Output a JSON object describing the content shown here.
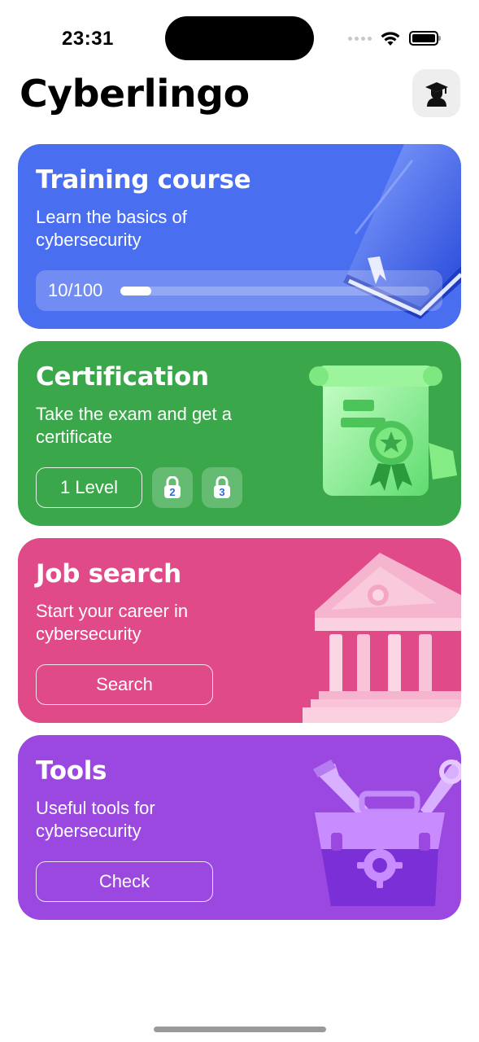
{
  "status_bar": {
    "time": "23:31"
  },
  "header": {
    "app_title": "Cyberlingo",
    "profile_icon": "student-graduation-cap-icon"
  },
  "cards": {
    "training": {
      "title": "Training course",
      "description": "Learn the basics of cybersecurity",
      "progress_text": "10/100",
      "progress_value": 10,
      "progress_max": 100,
      "color": "#4a6ef0",
      "illustration": "book-icon"
    },
    "certification": {
      "title": "Certification",
      "description": "Take the exam and get a certificate",
      "level_label": "1 Level",
      "locked_levels": [
        "2",
        "3"
      ],
      "color": "#3aa84a",
      "illustration": "certificate-scroll-icon"
    },
    "job_search": {
      "title": "Job search",
      "description": "Start your career in cybersecurity",
      "button_label": "Search",
      "color": "#e04a88",
      "illustration": "building-icon"
    },
    "tools": {
      "title": "Tools",
      "description": "Useful tools for cybersecurity",
      "button_label": "Check",
      "color": "#9a48e0",
      "illustration": "toolbox-icon"
    }
  }
}
